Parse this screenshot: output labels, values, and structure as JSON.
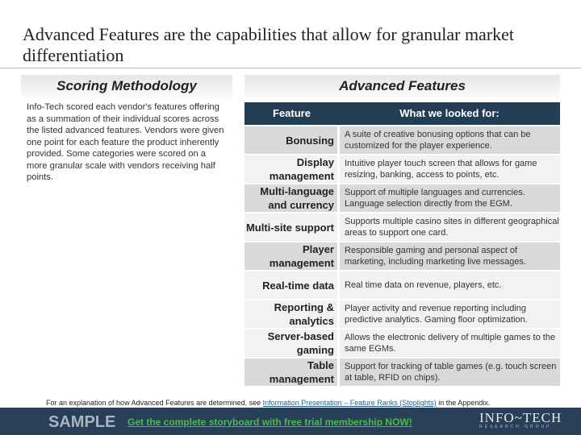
{
  "title": "Advanced Features are the capabilities that allow for granular market differentiation",
  "left": {
    "heading": "Scoring Methodology",
    "body": "Info-Tech scored each vendor's features offering as a summation of their individual scores across the listed advanced features. Vendors were given one point for each feature the product inherently provided. Some categories were scored on a more granular scale with vendors receiving half points."
  },
  "right": {
    "heading": "Advanced Features",
    "col1": "Feature",
    "col2": "What we looked for:",
    "rows": [
      {
        "feature": "Bonusing",
        "desc": "A suite of creative bonusing options that can be customized for the player experience."
      },
      {
        "feature": "Display management",
        "desc": "Intuitive player touch screen that allows for game resizing, banking, access to points, etc."
      },
      {
        "feature": "Multi-language and currency",
        "desc": "Support of multiple languages and currencies. Language selection directly from the EGM."
      },
      {
        "feature": "Multi-site support",
        "desc": "Supports multiple casino sites in different geographical areas to support one card."
      },
      {
        "feature": "Player management",
        "desc": "Responsible gaming and personal aspect of marketing, including marketing live messages."
      },
      {
        "feature": "Real-time data",
        "desc": "Real time data on revenue, players, etc."
      },
      {
        "feature": "Reporting & analytics",
        "desc": "Player activity and revenue reporting including predictive analytics. Gaming floor optimization."
      },
      {
        "feature": "Server-based gaming",
        "desc": "Allows the electronic delivery of multiple games to the same EGMs."
      },
      {
        "feature": "Table management",
        "desc": "Support for tracking of table games (e.g. touch screen at table, RFID on chips)."
      }
    ]
  },
  "footnote": {
    "pre": "For an explanation of how Advanced Features are determined, see ",
    "link": "Information Presentation – Feature Ranks (Stoplights)",
    "post": " in the Appendix."
  },
  "footer": {
    "sample": "SAMPLE",
    "cta": "Get the complete storyboard with free trial membership NOW!",
    "logo": "INFO~TECH",
    "logo_sub": "RESEARCH GROUP",
    "bg": "#273f57"
  }
}
